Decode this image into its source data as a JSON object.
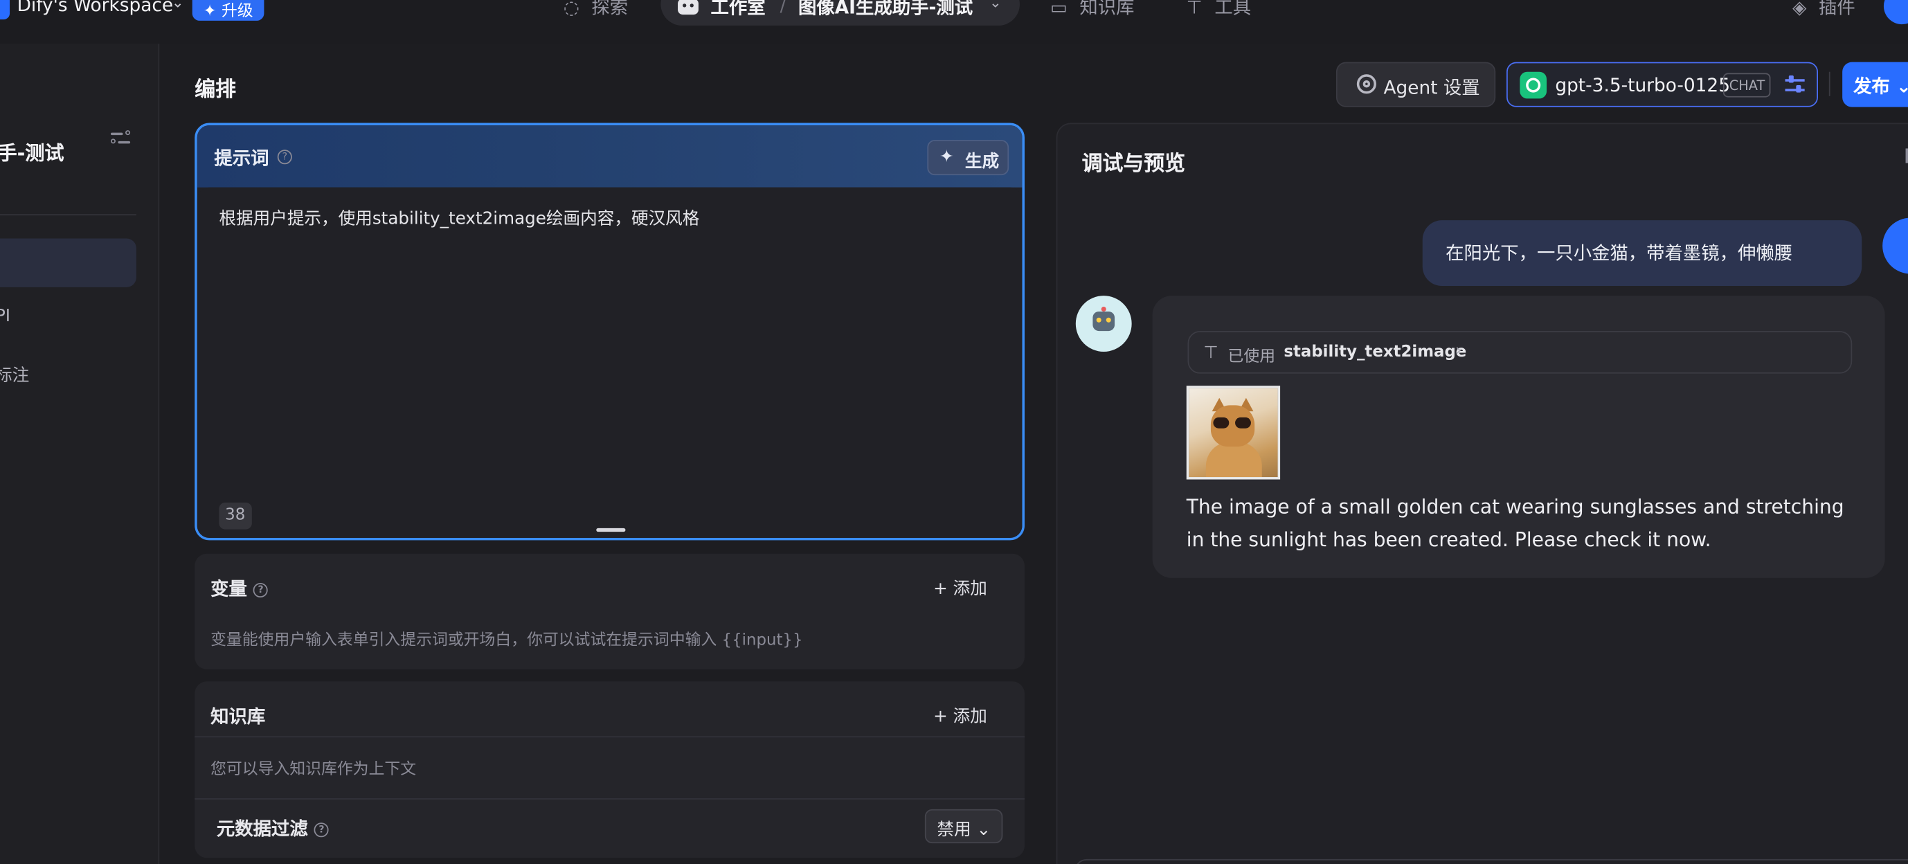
{
  "topnav": {
    "workspace": "Dify's Workspace",
    "upgrade": "升级",
    "explore": "探索",
    "studio": "工作室",
    "app_name": "图像AI生成助手-测试",
    "knowledge": "知识库",
    "tools": "工具",
    "plugins": "插件"
  },
  "sidebar": {
    "app_title": "手-测试",
    "items": [
      "PI",
      "标注"
    ]
  },
  "header": {
    "title": "编排",
    "agent_settings": "Agent 设置",
    "model_name": "gpt-3.5-turbo-0125",
    "model_mode": "CHAT",
    "publish": "发布"
  },
  "prompt": {
    "label": "提示词",
    "generate": "生成",
    "text": "根据用户提示，使用stability_text2image绘画内容，硬汉风格",
    "char_count": "38"
  },
  "variables": {
    "label": "变量",
    "add": "添加",
    "description": "变量能使用户输入表单引入提示词或开场白，你可以试试在提示词中输入 {{input}}"
  },
  "knowledge": {
    "label": "知识库",
    "add": "添加",
    "description": "您可以导入知识库作为上下文",
    "metadata_filter": "元数据过滤",
    "metadata_value": "禁用"
  },
  "debug": {
    "title": "调试与预览",
    "user_message": "在阳光下，一只小金猫，带着墨镜，伸懒腰",
    "tool_used_prefix": "已使用",
    "tool_name": "stability_text2image",
    "bot_reply": "The image of a small golden cat wearing sunglasses and stretching in the sunlight has been created. Please check it now."
  },
  "colors": {
    "accent": "#296dff",
    "prompt_border": "#3a8df5",
    "background": "#1d1d21"
  }
}
